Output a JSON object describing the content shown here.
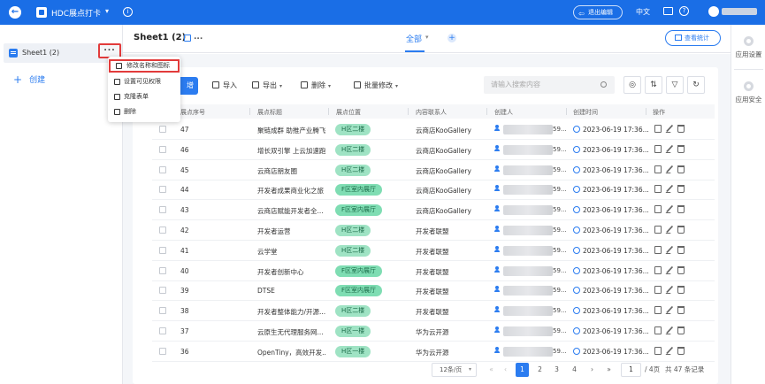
{
  "topbar": {
    "app_title": "HDC展点打卡",
    "exit_edit": "退出编辑",
    "language": "中文"
  },
  "sidebar": {
    "sheet_label": "Sheet1 (2)",
    "more": "...",
    "create_label": "创建"
  },
  "context_menu": {
    "items": [
      "修改名称和图标",
      "设置可见权限",
      "克隆表单",
      "删除"
    ]
  },
  "header": {
    "sheet_title": "Sheet1 (2)",
    "title_more": "...",
    "view_tab": "全部",
    "stats_button": "查看统计"
  },
  "right_panel": {
    "items": [
      "应用设置",
      "应用安全"
    ]
  },
  "toolbar": {
    "add_label": "增",
    "import_label": "导入",
    "export_label": "导出",
    "delete_label": "删除",
    "batch_edit_label": "批量修改",
    "search_placeholder": "请输入搜索内容"
  },
  "table": {
    "columns": [
      "展点序号",
      "展点标题",
      "展点位置",
      "内容联系人",
      "创建人",
      "创建时间",
      "操作"
    ],
    "rows": [
      {
        "id": "47",
        "title": "聚链成群 助推产业腾飞",
        "location": "H区二楼",
        "contact": "云商店KooGallery",
        "creator_tail": "59...",
        "time": "2023-06-19 17:36..."
      },
      {
        "id": "46",
        "title": "增长双引擎 上云加速跑",
        "location": "H区二楼",
        "contact": "云商店KooGallery",
        "creator_tail": "59...",
        "time": "2023-06-19 17:36..."
      },
      {
        "id": "45",
        "title": "云商店朋友圈",
        "location": "H区二楼",
        "contact": "云商店KooGallery",
        "creator_tail": "59...",
        "time": "2023-06-19 17:36..."
      },
      {
        "id": "44",
        "title": "开发者成果商业化之旅",
        "location": "F区室内展厅",
        "contact": "云商店KooGallery",
        "creator_tail": "59...",
        "time": "2023-06-19 17:36..."
      },
      {
        "id": "43",
        "title": "云商店赋能开发者全...",
        "location": "F区室内展厅",
        "contact": "云商店KooGallery",
        "creator_tail": "59...",
        "time": "2023-06-19 17:36..."
      },
      {
        "id": "42",
        "title": "开发者运营",
        "location": "H区二楼",
        "contact": "开发者联盟",
        "creator_tail": "59...",
        "time": "2023-06-19 17:36..."
      },
      {
        "id": "41",
        "title": "云学堂",
        "location": "H区二楼",
        "contact": "开发者联盟",
        "creator_tail": "59...",
        "time": "2023-06-19 17:36..."
      },
      {
        "id": "40",
        "title": "开发者创新中心",
        "location": "F区室内展厅",
        "contact": "开发者联盟",
        "creator_tail": "59...",
        "time": "2023-06-19 17:36..."
      },
      {
        "id": "39",
        "title": "DTSE",
        "location": "F区室内展厅",
        "contact": "开发者联盟",
        "creator_tail": "59...",
        "time": "2023-06-19 17:36..."
      },
      {
        "id": "38",
        "title": "开发者整体能力/开源...",
        "location": "H区二楼",
        "contact": "开发者联盟",
        "creator_tail": "59...",
        "time": "2023-06-19 17:36..."
      },
      {
        "id": "37",
        "title": "云原生无代理服务网...",
        "location": "H区一楼",
        "contact": "华为云开源",
        "creator_tail": "59...",
        "time": "2023-06-19 17:36..."
      },
      {
        "id": "36",
        "title": "OpenTiny，高效开发...",
        "location": "H区一楼",
        "contact": "华为云开源",
        "creator_tail": "59...",
        "time": "2023-06-19 17:36..."
      }
    ]
  },
  "pagination": {
    "page_size": "12条/页",
    "pages": [
      "1",
      "2",
      "3",
      "4"
    ],
    "current_page": "1",
    "jump_value": "1",
    "total_pages": "/ 4页",
    "total_records": "共 47 条记录"
  }
}
